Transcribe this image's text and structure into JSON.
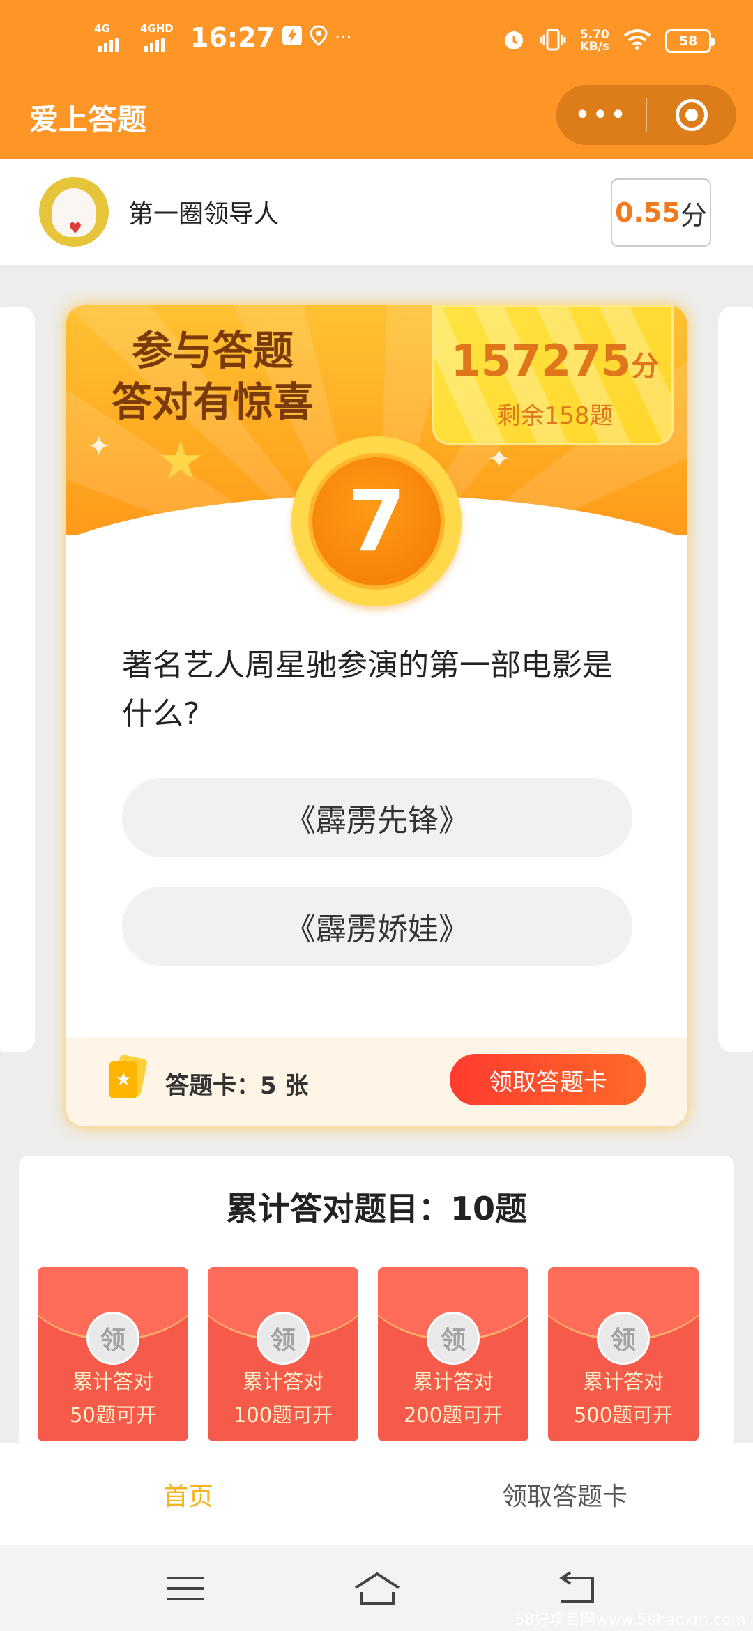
{
  "status_bar": {
    "time": "16:27",
    "sim1": "4G",
    "sim2": "4GHD",
    "net_speed_value": "5.70",
    "net_speed_unit": "KB/s",
    "battery": "58"
  },
  "header": {
    "title": "爱上答题",
    "more_glyph": "•••"
  },
  "user": {
    "name": "第一圈领导人",
    "score": "0.55",
    "score_unit": "分"
  },
  "card": {
    "slogan_line1": "参与答题",
    "slogan_line2": "答对有惊喜",
    "prize_score": "157275",
    "prize_unit": "分",
    "remaining": "剩余158题",
    "question_number": "7",
    "question": "著名艺人周星驰参演的第一部电影是什么?",
    "options": [
      "《霹雳先锋》",
      "《霹雳娇娃》"
    ],
    "cards_label": "答题卡：5 张",
    "get_card_button": "领取答题卡"
  },
  "accumulated": {
    "title": "累计答对题目：10题",
    "envelopes": [
      {
        "seal": "领",
        "line1": "累计答对",
        "line2": "50题可开"
      },
      {
        "seal": "领",
        "line1": "累计答对",
        "line2": "100题可开"
      },
      {
        "seal": "领",
        "line1": "累计答对",
        "line2": "200题可开"
      },
      {
        "seal": "领",
        "line1": "累计答对",
        "line2": "500题可开"
      }
    ]
  },
  "tabs": [
    {
      "label": "首页",
      "active": true
    },
    {
      "label": "领取答题卡",
      "active": false
    }
  ],
  "icons": {
    "status": [
      "signal-icon",
      "bolt-icon",
      "location-icon",
      "alarm-icon",
      "vibrate-icon",
      "wifi-icon",
      "battery-icon"
    ],
    "header": [
      "more-icon",
      "target-icon"
    ],
    "nav": [
      "menu-icon",
      "home-icon",
      "back-icon"
    ]
  },
  "colors": {
    "brand_orange": "#fd9527",
    "accent_red": "#ff3b2f",
    "tab_active": "#f5b321"
  },
  "watermark": "58好项目网www.58haoxm.com"
}
